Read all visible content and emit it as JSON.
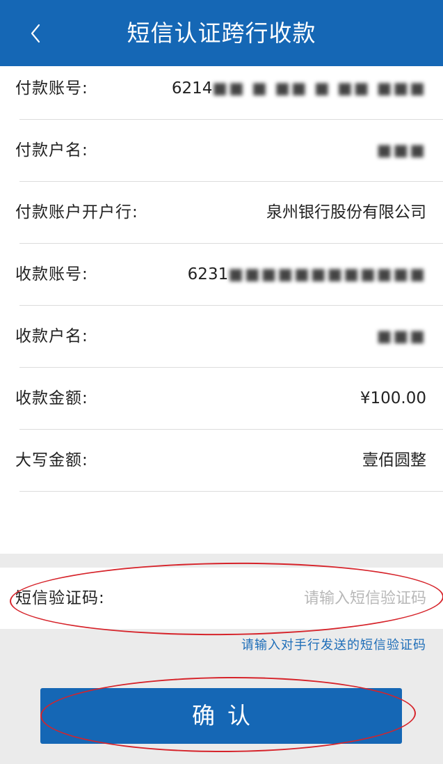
{
  "header": {
    "title": "短信认证跨行收款",
    "back_icon": "chevron-left-icon"
  },
  "details": [
    {
      "label": "付款账号:",
      "value_prefix": "6214",
      "value_masked": "■■ ■ ■■ ■ ■■ ■■■"
    },
    {
      "label": "付款户名:",
      "value_prefix": "",
      "value_masked": "■■■"
    },
    {
      "label": "付款账户开户行:",
      "value_prefix": "泉州银行股份有限公司",
      "value_masked": ""
    },
    {
      "label": "收款账号:",
      "value_prefix": "6231",
      "value_masked": "■■■■■■■■■■■■"
    },
    {
      "label": "收款户名:",
      "value_prefix": "",
      "value_masked": "■■■"
    },
    {
      "label": "收款金额:",
      "value_prefix": "¥100.00",
      "value_masked": ""
    },
    {
      "label": "大写金额:",
      "value_prefix": "壹佰圆整",
      "value_masked": ""
    }
  ],
  "sms": {
    "label": "短信验证码:",
    "placeholder": "请输入短信验证码",
    "value": ""
  },
  "hint": "请输入对手行发送的短信验证码",
  "confirm_label": "确认",
  "colors": {
    "brand_blue": "#1567b5",
    "hint_blue": "#1d6db8",
    "annotation_red": "#d6232a",
    "background_gray": "#ebebeb"
  }
}
